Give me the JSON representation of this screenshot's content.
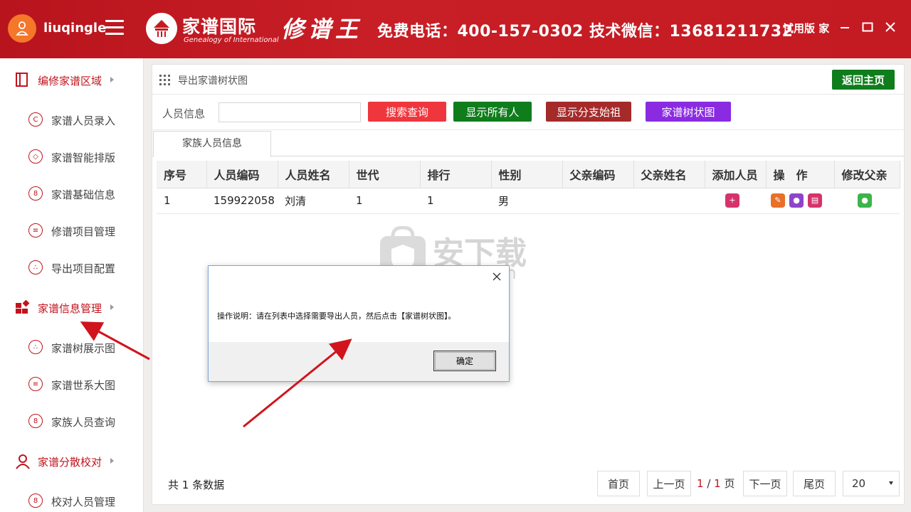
{
  "header": {
    "username": "liuqingle",
    "logo_text": "家谱国际",
    "logo_sub": "Genealogy of International",
    "slogan": "修谱王",
    "phone": "免费电话：400-157-0302 技术微信：13681211732",
    "trial": "试用版 家"
  },
  "sidebar": {
    "groups": [
      {
        "label": "编修家谱区域",
        "items": [
          "家谱人员录入",
          "家谱智能排版",
          "家谱基础信息",
          "修谱项目管理",
          "导出项目配置"
        ]
      },
      {
        "label": "家谱信息管理",
        "items": [
          "家谱树展示图",
          "家谱世系大图",
          "家族人员查询"
        ]
      },
      {
        "label": "家谱分散校对",
        "items": [
          "校对人员管理"
        ]
      }
    ]
  },
  "main": {
    "breadcrumb": "导出家谱树状图",
    "back_label": "返回主页",
    "search_label": "人员信息",
    "search_value": "",
    "buttons": {
      "search": "搜索查询",
      "show_all": "显示所有人",
      "show_branch": "显示分支始祖",
      "tree": "家谱树状图"
    },
    "tab": "家族人员信息",
    "columns": [
      "序号",
      "人员编码",
      "人员姓名",
      "世代",
      "排行",
      "性别",
      "父亲编码",
      "父亲姓名",
      "添加人员",
      "操　作",
      "修改父亲"
    ],
    "rows": [
      {
        "index": "1",
        "code": "159922058",
        "name": "刘清",
        "generation": "1",
        "rank": "1",
        "gender": "男",
        "father_code": "",
        "father_name": ""
      }
    ],
    "count_text": "共 1 条数据",
    "pager": {
      "first": "首页",
      "prev": "上一页",
      "current": "1",
      "sep": "/",
      "total": "1",
      "unit": "页",
      "next": "下一页",
      "last": "尾页",
      "size": "20"
    }
  },
  "watermark": {
    "text": "安下载",
    "domain": "anxz.com"
  },
  "dialog": {
    "message": "操作说明：请在列表中选择需要导出人员，然后点击【家谱树状图】。",
    "ok_label": "确定"
  },
  "colors": {
    "brand_red": "#c41a22",
    "green": "#0f7d1c",
    "purple": "#8a2be2",
    "darkred": "#a52a2a",
    "red_btn": "#f0363d"
  }
}
